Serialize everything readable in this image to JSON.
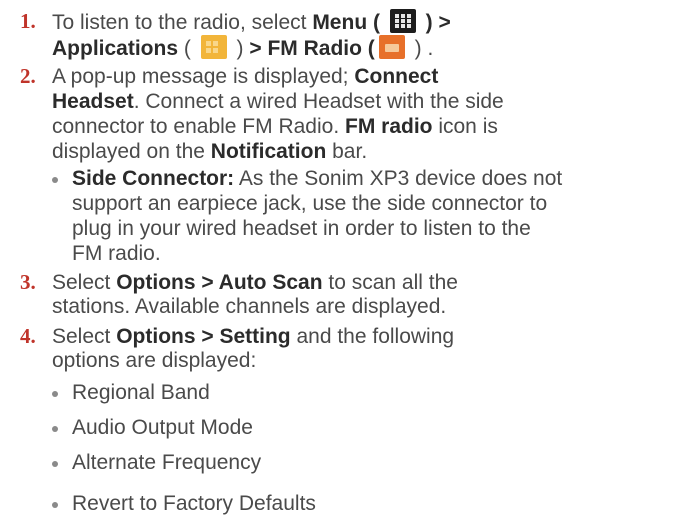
{
  "steps": [
    {
      "number": "1.",
      "line1": {
        "a": "To listen to the radio, select ",
        "b_menu": "Menu",
        "c": " ( ",
        "d": " ) ",
        "e_gt": ">"
      },
      "line2": {
        "b_apps": "Applications",
        "c": " ( ",
        "d": " ) ",
        "e_bold": "> FM Radio",
        "f": " (",
        "g": " ) ."
      }
    },
    {
      "number": "2.",
      "lines": [
        {
          "pre": "A pop-up message is displayed; ",
          "bold": "Connect"
        },
        {
          "bold": "Headset",
          "post": ". Connect a wired Headset with the side"
        },
        {
          "text": "connector to enable FM Radio. ",
          "bold": "FM radio",
          "post": " icon is"
        },
        {
          "text": "displayed on the ",
          "bold": "Notification",
          "post": " bar."
        }
      ],
      "bullet": {
        "bold": "Side Connector:",
        "lines": [
          " As the Sonim XP3 device does not",
          "support an earpiece jack, use the side connector to",
          "plug in your wired headset in order to listen to the",
          "FM radio."
        ]
      }
    },
    {
      "number": "3.",
      "pre": "Select ",
      "bold": "Options > Auto Scan",
      "post": " to scan all the",
      "line2": "stations. Available channels are displayed."
    },
    {
      "number": "4.",
      "pre": "Select ",
      "bold": "Options > Setting",
      "post": " and the following",
      "line2": "options are displayed:",
      "options": [
        "Regional Band",
        "Audio Output Mode",
        "Alternate Frequency",
        "Revert to Factory Defaults"
      ]
    }
  ],
  "icons": {
    "menu": "menu-grid-icon",
    "applications": "applications-icon",
    "fm_radio": "fm-radio-icon"
  }
}
